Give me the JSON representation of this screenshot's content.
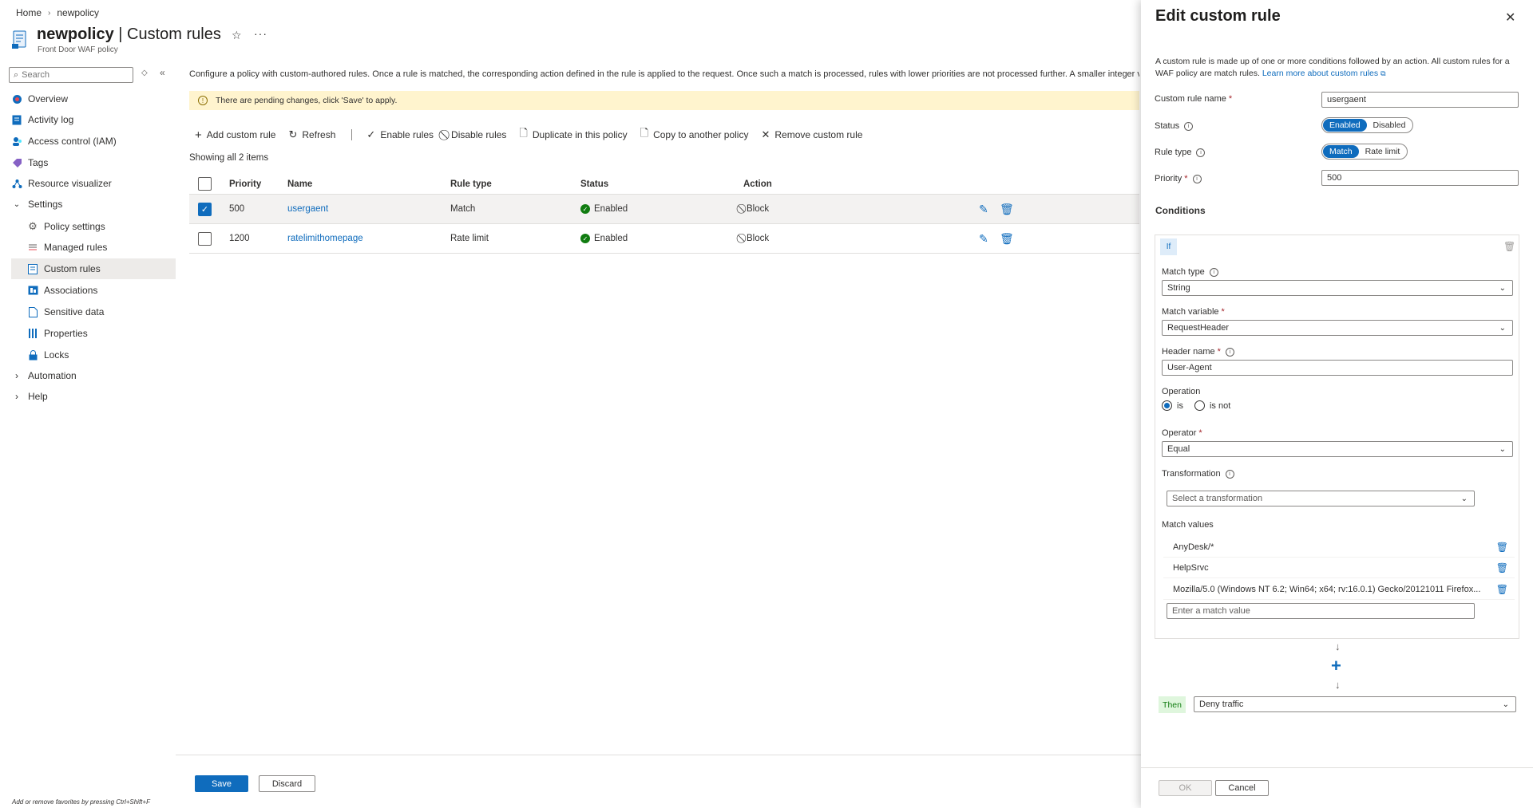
{
  "breadcrumb": {
    "home": "Home",
    "current": "newpolicy"
  },
  "header": {
    "resource": "newpolicy",
    "section": "| Custom rules",
    "subtitle": "Front Door WAF policy"
  },
  "sidebar": {
    "search_placeholder": "Search",
    "items": [
      {
        "label": "Overview",
        "icon": "overview-icon"
      },
      {
        "label": "Activity log",
        "icon": "activity-log-icon"
      },
      {
        "label": "Access control (IAM)",
        "icon": "iam-icon"
      },
      {
        "label": "Tags",
        "icon": "tag-icon"
      },
      {
        "label": "Resource visualizer",
        "icon": "visualizer-icon"
      },
      {
        "label": "Settings",
        "icon": "chevron-down-icon"
      },
      {
        "label": "Policy settings",
        "icon": "gear-icon"
      },
      {
        "label": "Managed rules",
        "icon": "managed-rules-icon"
      },
      {
        "label": "Custom rules",
        "icon": "custom-rules-icon"
      },
      {
        "label": "Associations",
        "icon": "associations-icon"
      },
      {
        "label": "Sensitive data",
        "icon": "sensitive-data-icon"
      },
      {
        "label": "Properties",
        "icon": "properties-icon"
      },
      {
        "label": "Locks",
        "icon": "lock-icon"
      },
      {
        "label": "Automation",
        "icon": "chevron-right-icon"
      },
      {
        "label": "Help",
        "icon": "chevron-right-icon"
      }
    ]
  },
  "main": {
    "description": "Configure a policy with custom-authored rules. Once a rule is matched, the corresponding action defined in the rule is applied to the request. Once such a match is processed, rules with lower priorities are not processed further. A smaller integer valu",
    "pending": "There are pending changes, click 'Save' to apply.",
    "toolbar": {
      "add": "Add custom rule",
      "refresh": "Refresh",
      "enable": "Enable rules",
      "disable": "Disable rules",
      "duplicate": "Duplicate in this policy",
      "copy": "Copy to another policy",
      "remove": "Remove custom rule"
    },
    "showing": "Showing all 2 items",
    "columns": [
      "Priority",
      "Name",
      "Rule type",
      "Status",
      "Action"
    ],
    "rows": [
      {
        "priority": "500",
        "name": "usergaent",
        "type": "Match",
        "status": "Enabled",
        "action": "Block",
        "checked": true
      },
      {
        "priority": "1200",
        "name": "ratelimithomepage",
        "type": "Rate limit",
        "status": "Enabled",
        "action": "Block",
        "checked": false
      }
    ],
    "save": "Save",
    "discard": "Discard",
    "favorites_hint": "Add or remove favorites by pressing Ctrl+Shift+F"
  },
  "panel": {
    "title": "Edit custom rule",
    "desc": "A custom rule is made up of one or more conditions followed by an action. All custom rules for a WAF policy are match rules.",
    "learn_more": "Learn more about custom rules",
    "name_label": "Custom rule name",
    "name_value": "usergaent",
    "status_label": "Status",
    "status_on": "Enabled",
    "status_off": "Disabled",
    "type_label": "Rule type",
    "type_on": "Match",
    "type_off": "Rate limit",
    "priority_label": "Priority",
    "priority_value": "500",
    "conditions": "Conditions",
    "if": "If",
    "match_type_label": "Match type",
    "match_type_value": "String",
    "match_var_label": "Match variable",
    "match_var_value": "RequestHeader",
    "header_label": "Header name",
    "header_value": "User-Agent",
    "operation_label": "Operation",
    "op_is": "is",
    "op_is_not": "is not",
    "operator_label": "Operator",
    "operator_value": "Equal",
    "transform_label": "Transformation",
    "transform_placeholder": "Select a transformation",
    "match_values_label": "Match values",
    "match_values": [
      "AnyDesk/*",
      "HelpSrvc",
      "Mozilla/5.0 (Windows NT 6.2; Win64; x64; rv:16.0.1) Gecko/20121011 Firefox..."
    ],
    "match_value_placeholder": "Enter a match value",
    "then": "Then",
    "then_value": "Deny traffic",
    "ok": "OK",
    "cancel": "Cancel"
  }
}
